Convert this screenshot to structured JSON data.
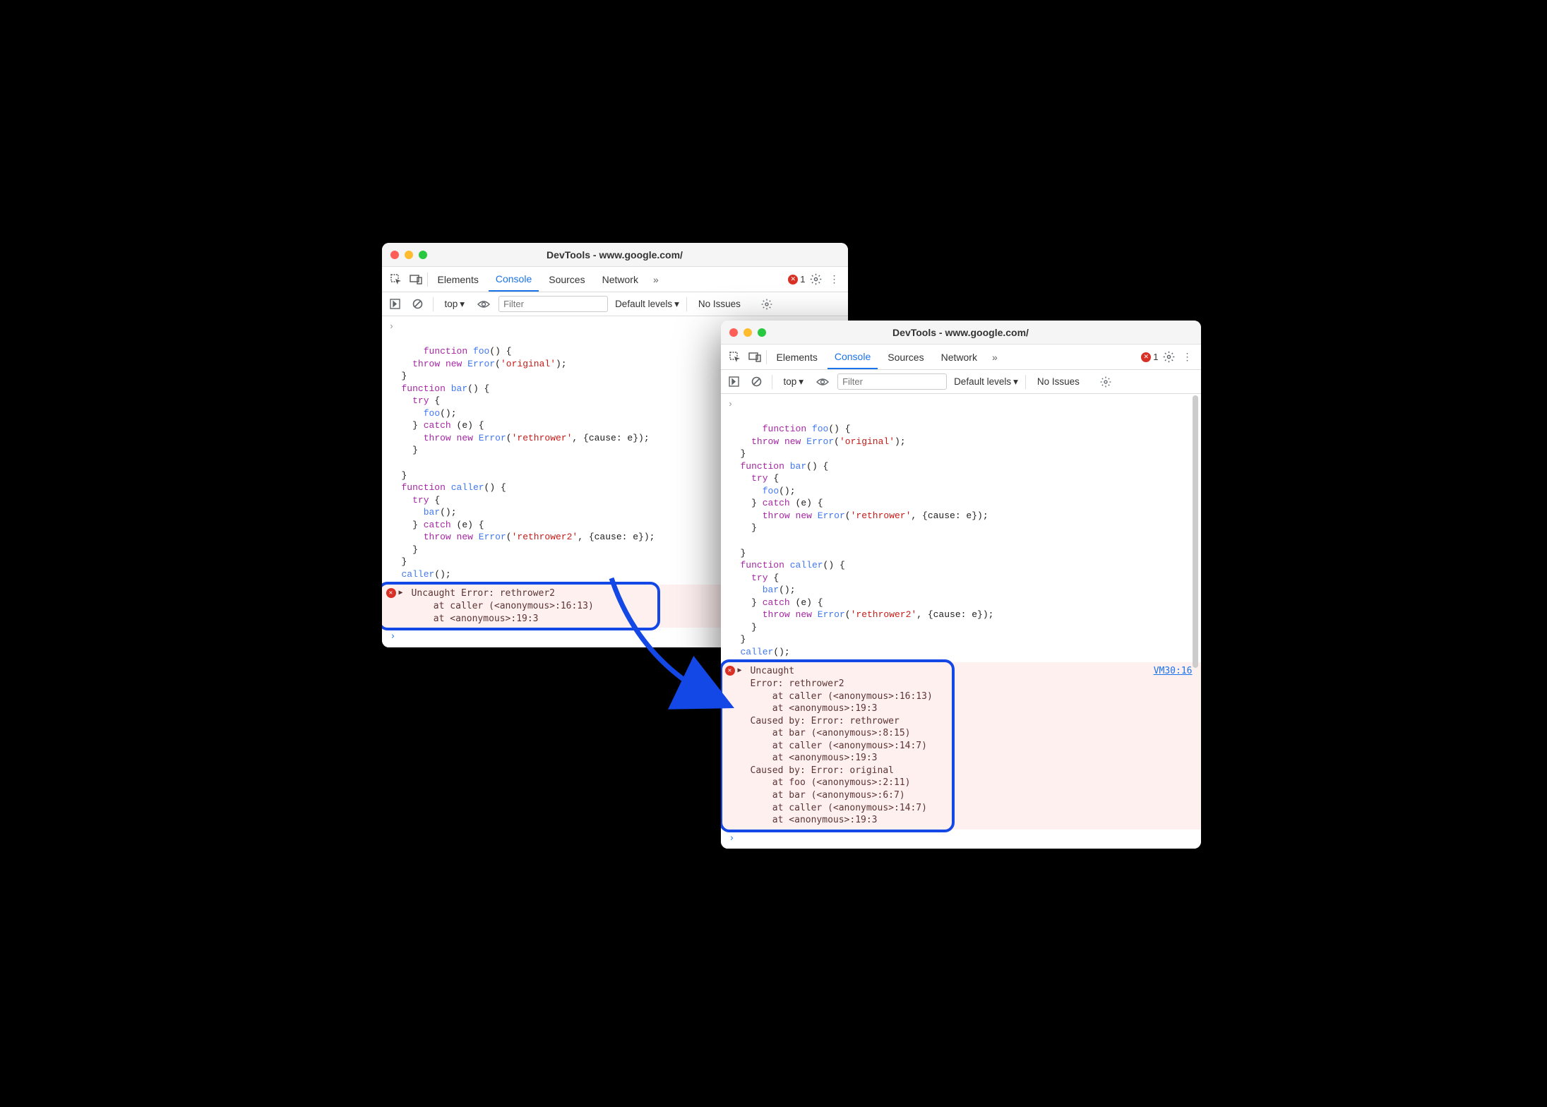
{
  "window1": {
    "title": "DevTools - www.google.com/",
    "tabs": {
      "elements": "Elements",
      "console": "Console",
      "sources": "Sources",
      "network": "Network"
    },
    "error_count": "1",
    "filter": {
      "context": "top",
      "placeholder": "Filter",
      "levels": "Default levels",
      "issues": "No Issues"
    },
    "code": "function foo() {\n  throw new Error('original');\n}\nfunction bar() {\n  try {\n    foo();\n  } catch (e) {\n    throw new Error('rethrower', {cause: e});\n  }\n\n}\nfunction caller() {\n  try {\n    bar();\n  } catch (e) {\n    throw new Error('rethrower2', {cause: e});\n  }\n}\ncaller();",
    "error_text": "Uncaught Error: rethrower2\n    at caller (<anonymous>:16:13)\n    at <anonymous>:19:3"
  },
  "window2": {
    "title": "DevTools - www.google.com/",
    "tabs": {
      "elements": "Elements",
      "console": "Console",
      "sources": "Sources",
      "network": "Network"
    },
    "error_count": "1",
    "filter": {
      "context": "top",
      "placeholder": "Filter",
      "levels": "Default levels",
      "issues": "No Issues"
    },
    "code": "function foo() {\n  throw new Error('original');\n}\nfunction bar() {\n  try {\n    foo();\n  } catch (e) {\n    throw new Error('rethrower', {cause: e});\n  }\n\n}\nfunction caller() {\n  try {\n    bar();\n  } catch (e) {\n    throw new Error('rethrower2', {cause: e});\n  }\n}\ncaller();",
    "error_header": "Uncaught",
    "error_source": "VM30:16",
    "error_text": "Error: rethrower2\n    at caller (<anonymous>:16:13)\n    at <anonymous>:19:3\nCaused by: Error: rethrower\n    at bar (<anonymous>:8:15)\n    at caller (<anonymous>:14:7)\n    at <anonymous>:19:3\nCaused by: Error: original\n    at foo (<anonymous>:2:11)\n    at bar (<anonymous>:6:7)\n    at caller (<anonymous>:14:7)\n    at <anonymous>:19:3"
  }
}
